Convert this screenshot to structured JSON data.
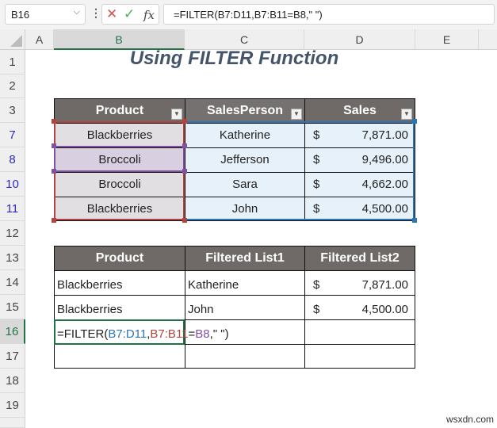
{
  "formula_bar": {
    "name_box": "B16",
    "cancel_icon": "✕",
    "enter_icon": "✓",
    "fx_label": "fx",
    "formula": "=FILTER(B7:D11,B7:B11=B8,\" \")"
  },
  "columns": [
    "A",
    "B",
    "C",
    "D",
    "E"
  ],
  "selected_column": "B",
  "rows": [
    "1",
    "2",
    "3",
    "7",
    "8",
    "10",
    "11",
    "12",
    "13",
    "14",
    "15",
    "16",
    "17",
    "18",
    "19"
  ],
  "title": "Using FILTER Function",
  "source_table": {
    "headers": [
      "Product",
      "SalesPerson",
      "Sales"
    ],
    "rows": [
      {
        "row": "7",
        "product": "Blackberries",
        "salesperson": "Katherine",
        "currency": "$",
        "sales": "7,871.00"
      },
      {
        "row": "8",
        "product": "Broccoli",
        "salesperson": "Jefferson",
        "currency": "$",
        "sales": "9,496.00"
      },
      {
        "row": "10",
        "product": "Broccoli",
        "salesperson": "Sara",
        "currency": "$",
        "sales": "4,662.00"
      },
      {
        "row": "11",
        "product": "Blackberries",
        "salesperson": "John",
        "currency": "$",
        "sales": "4,500.00"
      }
    ]
  },
  "result_table": {
    "headers": [
      "Product",
      "Filtered List1",
      "Filtered List2"
    ],
    "rows": [
      {
        "product": "Blackberries",
        "list1": "Katherine",
        "currency": "$",
        "list2": "7,871.00"
      },
      {
        "product": "Blackberries",
        "list1": "John",
        "currency": "$",
        "list2": "4,500.00"
      }
    ]
  },
  "editing_formula": {
    "part1": "=FILTER(",
    "ref1": "B7:D11",
    "comma1": ",",
    "ref2": "B7:B11",
    "eq": "=",
    "ref3": "B8",
    "part2": ",\" \")"
  },
  "watermark": "wsxdn.com",
  "colors": {
    "accent": "#217346",
    "header_bg": "#6f6a68",
    "ref_blue": "#2e75b6",
    "ref_red": "#b0453f",
    "ref_purple": "#7f4fa0"
  }
}
